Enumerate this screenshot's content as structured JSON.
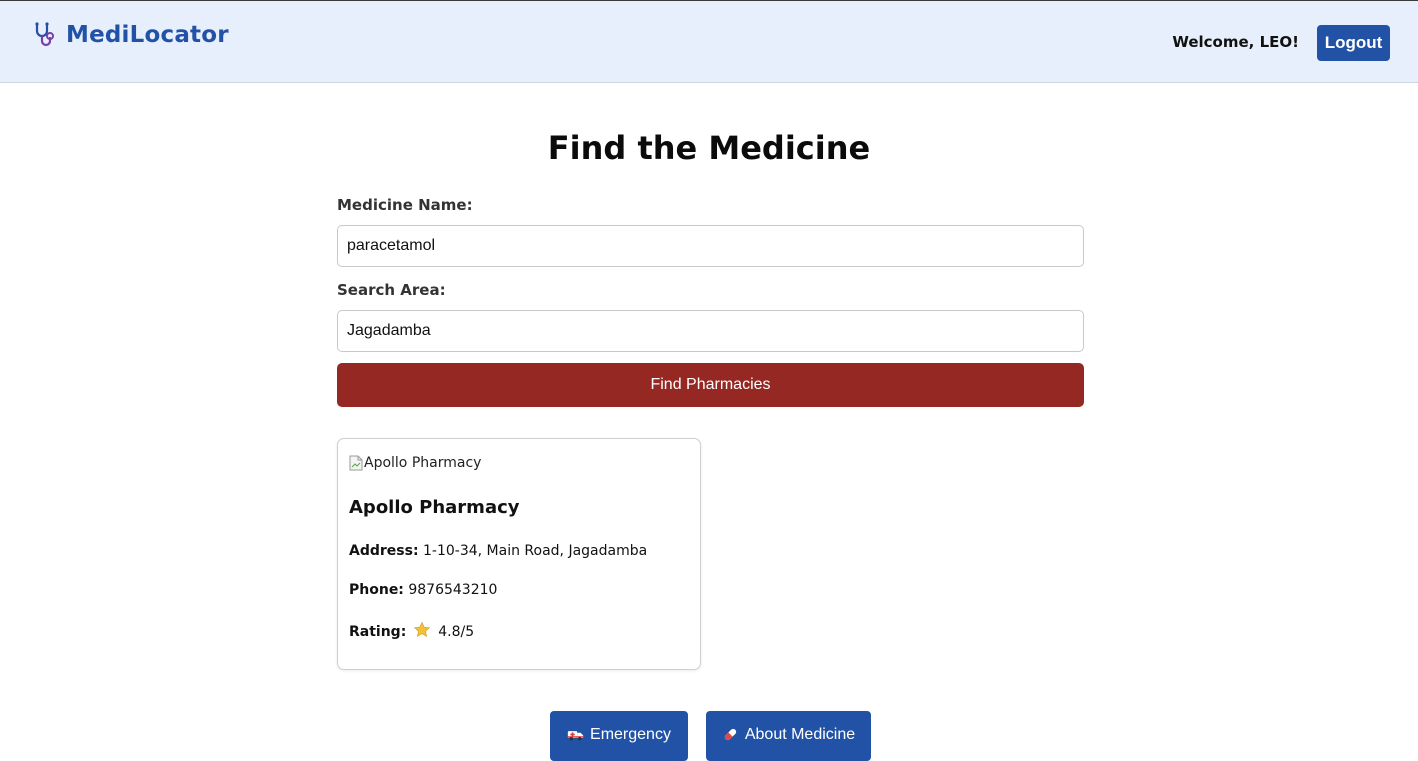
{
  "header": {
    "app_name": "MediLocator",
    "logo_icon": "stethoscope-icon",
    "welcome_text": "Welcome, LEO!",
    "logout_label": "Logout",
    "background_color": "#e8effc",
    "brand_color": "#2152a6"
  },
  "main": {
    "title": "Find the Medicine",
    "medicine": {
      "label": "Medicine Name:",
      "value": "paracetamol"
    },
    "area": {
      "label": "Search Area:",
      "value": "Jagadamba"
    },
    "find_button_label": "Find Pharmacies",
    "find_button_color": "#962823"
  },
  "results": [
    {
      "image_alt": "Apollo Pharmacy",
      "name": "Apollo Pharmacy",
      "address_label": "Address:",
      "address": "1-10-34, Main Road, Jagadamba",
      "phone_label": "Phone:",
      "phone": "9876543210",
      "rating_label": "Rating:",
      "rating_icon": "star-icon",
      "rating": "4.8/5"
    }
  ],
  "footer_buttons": {
    "emergency": {
      "label": "Emergency",
      "icon": "ambulance-icon"
    },
    "about_medicine": {
      "label": "About Medicine",
      "icon": "pill-icon"
    }
  }
}
